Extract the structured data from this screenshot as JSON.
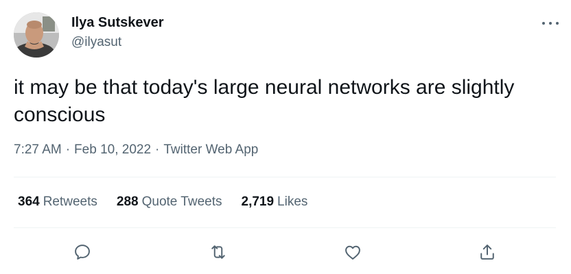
{
  "author": {
    "display_name": "Ilya Sutskever",
    "handle": "@ilyasut",
    "avatar_icon": "profile-photo"
  },
  "tweet": {
    "text": "it may be that today's large neural networks are slightly conscious",
    "time": "7:27 AM",
    "date": "Feb 10, 2022",
    "source": "Twitter Web App",
    "separator": "·"
  },
  "stats": {
    "retweets": {
      "count": "364",
      "label": "Retweets"
    },
    "quote_tweets": {
      "count": "288",
      "label": "Quote Tweets"
    },
    "likes": {
      "count": "2,719",
      "label": "Likes"
    }
  },
  "actions": {
    "reply_icon": "reply-icon",
    "retweet_icon": "retweet-icon",
    "like_icon": "heart-icon",
    "share_icon": "share-icon"
  },
  "colors": {
    "text_primary": "#0f1419",
    "text_secondary": "#536471",
    "divider": "#eff3f4"
  }
}
